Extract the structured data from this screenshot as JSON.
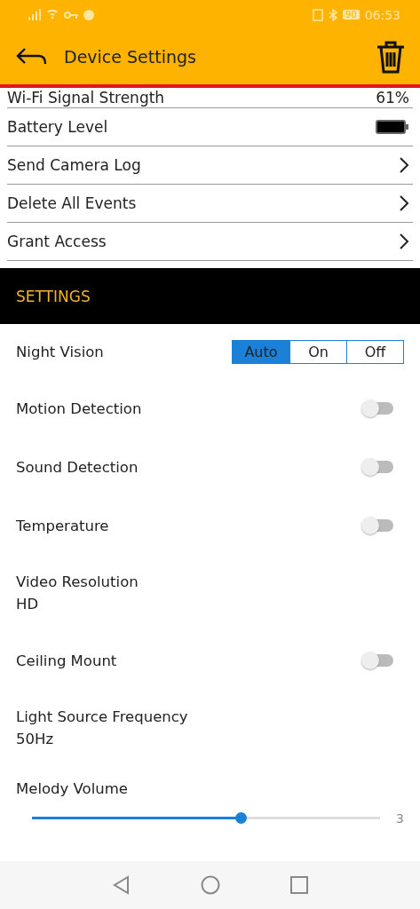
{
  "status_bar": {
    "battery": "90",
    "time": "06:53"
  },
  "header": {
    "title": "Device Settings"
  },
  "info_rows": [
    {
      "kind": "value",
      "label": "Wi-Fi Signal Strength",
      "value": "61%"
    },
    {
      "kind": "battery",
      "label": "Battery Level"
    },
    {
      "kind": "link",
      "label": "Send Camera Log"
    },
    {
      "kind": "link",
      "label": "Delete All Events"
    },
    {
      "kind": "link",
      "label": "Grant Access"
    }
  ],
  "section": {
    "title": "SETTINGS"
  },
  "settings": [
    {
      "kind": "segmented",
      "label": "Night Vision",
      "options": [
        {
          "label": "Auto",
          "selected": true
        },
        {
          "label": "On",
          "selected": false
        },
        {
          "label": "Off",
          "selected": false
        }
      ]
    },
    {
      "kind": "toggle",
      "label": "Motion Detection",
      "on": false
    },
    {
      "kind": "toggle",
      "label": "Sound Detection",
      "on": false
    },
    {
      "kind": "toggle",
      "label": "Temperature",
      "on": false
    },
    {
      "kind": "value",
      "label": "Video Resolution",
      "value": "HD"
    },
    {
      "kind": "toggle",
      "label": "Ceiling Mount",
      "on": false
    },
    {
      "kind": "value",
      "label": "Light Source Frequency",
      "value": "50Hz"
    },
    {
      "kind": "slider",
      "label": "Melody Volume",
      "level": 0.6,
      "reading": "3"
    }
  ]
}
